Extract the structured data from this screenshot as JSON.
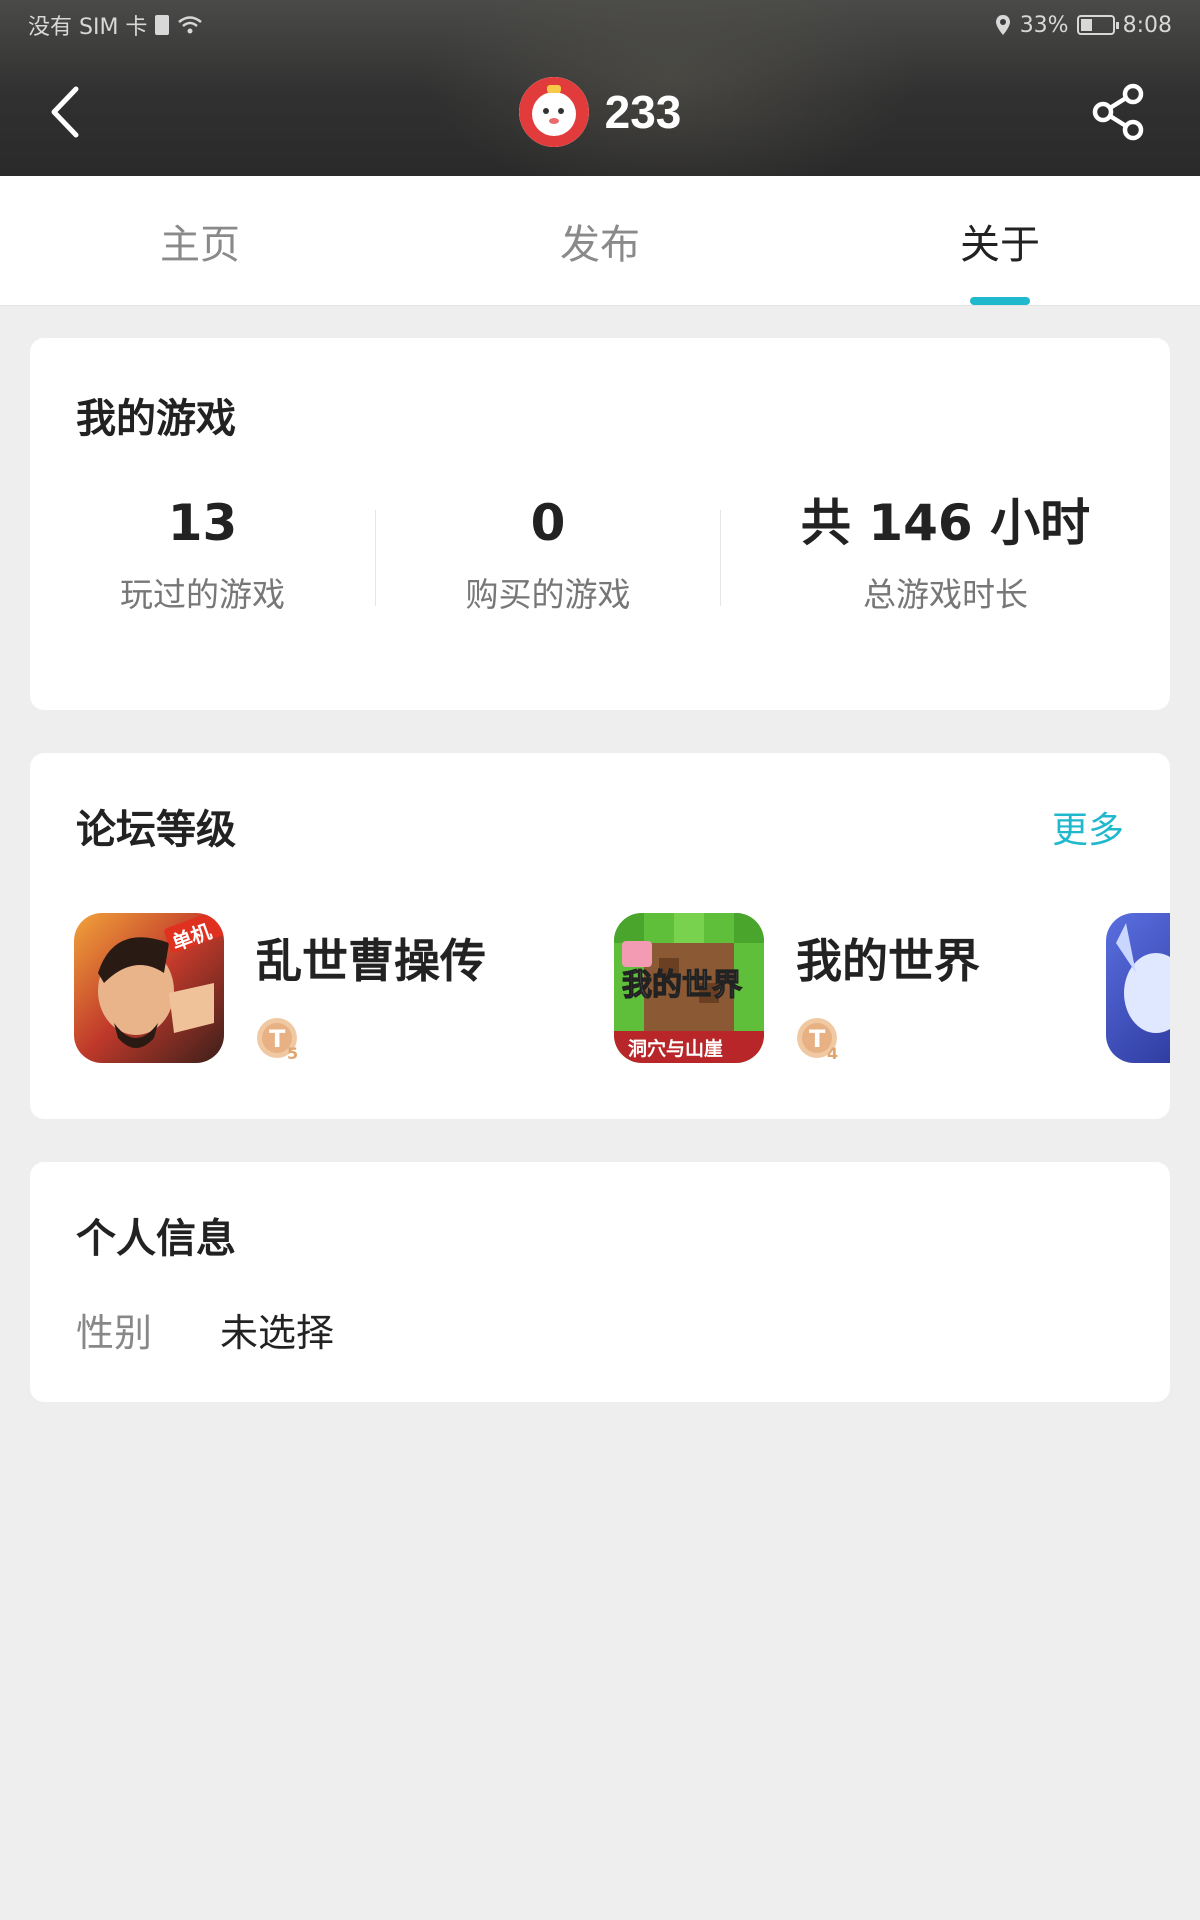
{
  "status_bar": {
    "carrier": "没有 SIM 卡",
    "battery_percent": "33%",
    "time": "8:08",
    "icons": [
      "sim-icon",
      "wifi-icon",
      "location-icon",
      "battery-icon"
    ]
  },
  "header": {
    "title": "233",
    "back_icon": "chevron-left-icon",
    "share_icon": "share-icon",
    "avatar_icon": "avatar"
  },
  "tabs": [
    {
      "label": "主页",
      "active": false
    },
    {
      "label": "发布",
      "active": false
    },
    {
      "label": "关于",
      "active": true
    }
  ],
  "my_games": {
    "title": "我的游戏",
    "stats": [
      {
        "value": "13",
        "label": "玩过的游戏"
      },
      {
        "value": "0",
        "label": "购买的游戏"
      },
      {
        "value": "共 146 小时",
        "label": "总游戏时长"
      }
    ]
  },
  "forum_level": {
    "title": "论坛等级",
    "more": "更多",
    "items": [
      {
        "name": "乱世曹操传",
        "icon_text": "单机",
        "level": "5"
      },
      {
        "name": "我的世界",
        "icon_text": "我的世界",
        "icon_subtext": "洞穴与山崖",
        "level": "4"
      }
    ]
  },
  "personal_info": {
    "title": "个人信息",
    "rows": [
      {
        "label": "性别",
        "value": "未选择"
      }
    ]
  },
  "colors": {
    "accent": "#20b8cc",
    "background": "#eeeeee",
    "header_dark": "#2e2e2e"
  }
}
